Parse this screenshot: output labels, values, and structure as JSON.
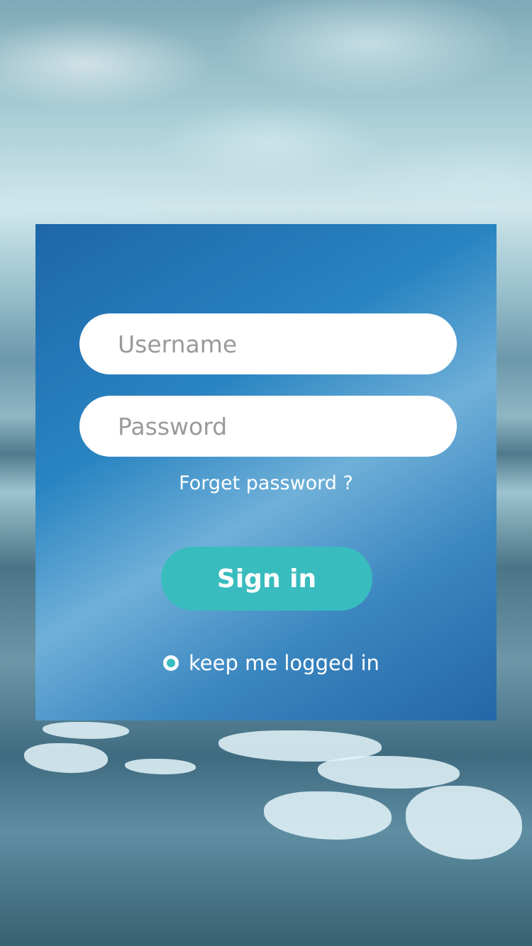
{
  "login": {
    "username_placeholder": "Username",
    "password_placeholder": "Password",
    "forgot_label": "Forget password ?",
    "signin_label": "Sign in",
    "keep_logged_label": "keep me logged in",
    "keep_logged_checked": true
  },
  "colors": {
    "panel": "#2a84c2",
    "accent": "#39bcbe",
    "field_bg": "#ffffff",
    "text": "#ffffff"
  }
}
